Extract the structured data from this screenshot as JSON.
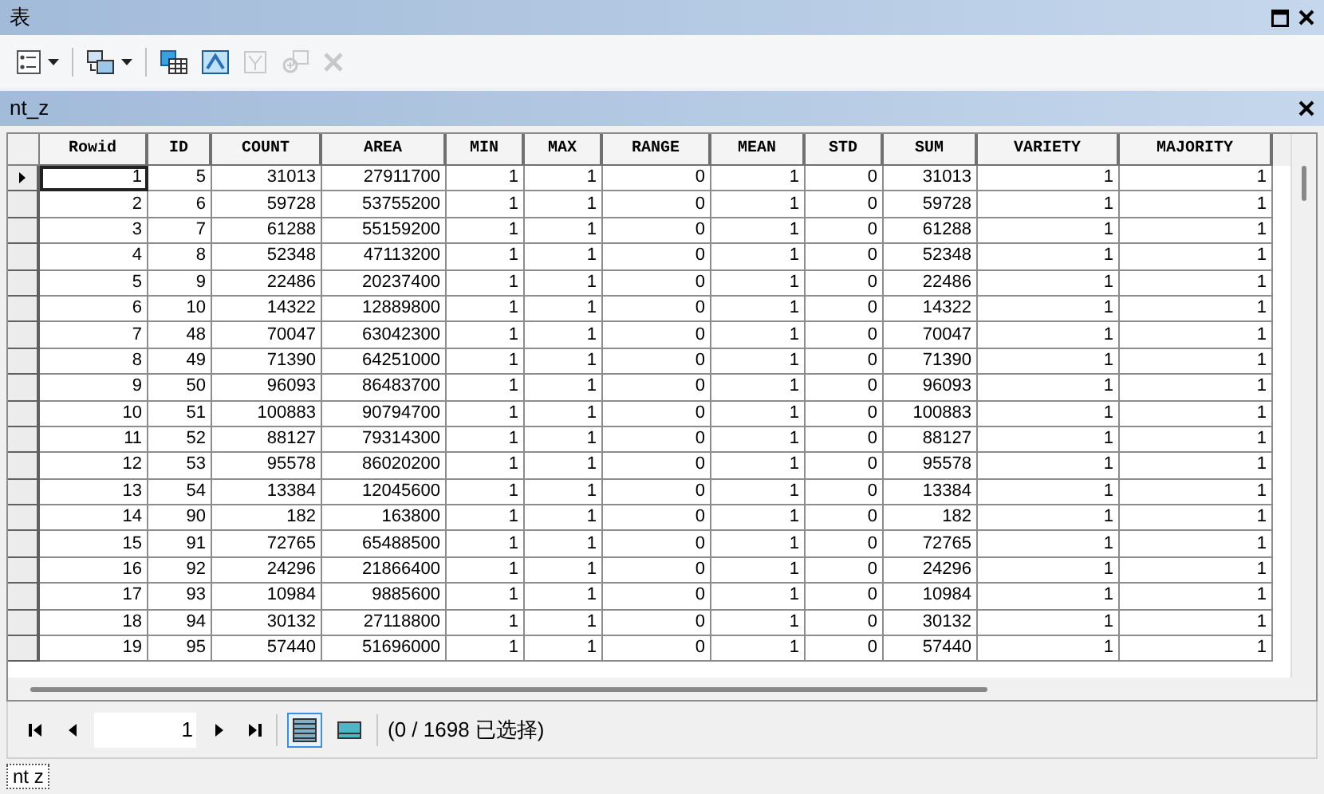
{
  "window": {
    "title": "表"
  },
  "toolbar": [
    {
      "kind": "options",
      "dropdown": true,
      "disabled": false
    },
    {
      "kind": "related",
      "dropdown": true,
      "disabled": false
    },
    {
      "kind": "select",
      "dropdown": false,
      "disabled": false
    },
    {
      "kind": "switch",
      "dropdown": false,
      "disabled": false
    },
    {
      "kind": "clear",
      "dropdown": false,
      "disabled": true
    },
    {
      "kind": "zoom",
      "dropdown": false,
      "disabled": true
    },
    {
      "kind": "delete",
      "dropdown": false,
      "disabled": true
    }
  ],
  "table_tab": {
    "title": "nt_z"
  },
  "table": {
    "columns": [
      "Rowid",
      "ID",
      "COUNT",
      "AREA",
      "MIN",
      "MAX",
      "RANGE",
      "MEAN",
      "STD",
      "SUM",
      "VARIETY",
      "MAJORITY"
    ],
    "rows": [
      {
        "current": true,
        "cells": [
          "1",
          "5",
          "31013",
          "27911700",
          "1",
          "1",
          "0",
          "1",
          "0",
          "31013",
          "1",
          "1"
        ]
      },
      {
        "current": false,
        "cells": [
          "2",
          "6",
          "59728",
          "53755200",
          "1",
          "1",
          "0",
          "1",
          "0",
          "59728",
          "1",
          "1"
        ]
      },
      {
        "current": false,
        "cells": [
          "3",
          "7",
          "61288",
          "55159200",
          "1",
          "1",
          "0",
          "1",
          "0",
          "61288",
          "1",
          "1"
        ]
      },
      {
        "current": false,
        "cells": [
          "4",
          "8",
          "52348",
          "47113200",
          "1",
          "1",
          "0",
          "1",
          "0",
          "52348",
          "1",
          "1"
        ]
      },
      {
        "current": false,
        "cells": [
          "5",
          "9",
          "22486",
          "20237400",
          "1",
          "1",
          "0",
          "1",
          "0",
          "22486",
          "1",
          "1"
        ]
      },
      {
        "current": false,
        "cells": [
          "6",
          "10",
          "14322",
          "12889800",
          "1",
          "1",
          "0",
          "1",
          "0",
          "14322",
          "1",
          "1"
        ]
      },
      {
        "current": false,
        "cells": [
          "7",
          "48",
          "70047",
          "63042300",
          "1",
          "1",
          "0",
          "1",
          "0",
          "70047",
          "1",
          "1"
        ]
      },
      {
        "current": false,
        "cells": [
          "8",
          "49",
          "71390",
          "64251000",
          "1",
          "1",
          "0",
          "1",
          "0",
          "71390",
          "1",
          "1"
        ]
      },
      {
        "current": false,
        "cells": [
          "9",
          "50",
          "96093",
          "86483700",
          "1",
          "1",
          "0",
          "1",
          "0",
          "96093",
          "1",
          "1"
        ]
      },
      {
        "current": false,
        "cells": [
          "10",
          "51",
          "100883",
          "90794700",
          "1",
          "1",
          "0",
          "1",
          "0",
          "100883",
          "1",
          "1"
        ]
      },
      {
        "current": false,
        "cells": [
          "11",
          "52",
          "88127",
          "79314300",
          "1",
          "1",
          "0",
          "1",
          "0",
          "88127",
          "1",
          "1"
        ]
      },
      {
        "current": false,
        "cells": [
          "12",
          "53",
          "95578",
          "86020200",
          "1",
          "1",
          "0",
          "1",
          "0",
          "95578",
          "1",
          "1"
        ]
      },
      {
        "current": false,
        "cells": [
          "13",
          "54",
          "13384",
          "12045600",
          "1",
          "1",
          "0",
          "1",
          "0",
          "13384",
          "1",
          "1"
        ]
      },
      {
        "current": false,
        "cells": [
          "14",
          "90",
          "182",
          "163800",
          "1",
          "1",
          "0",
          "1",
          "0",
          "182",
          "1",
          "1"
        ]
      },
      {
        "current": false,
        "cells": [
          "15",
          "91",
          "72765",
          "65488500",
          "1",
          "1",
          "0",
          "1",
          "0",
          "72765",
          "1",
          "1"
        ]
      },
      {
        "current": false,
        "cells": [
          "16",
          "92",
          "24296",
          "21866400",
          "1",
          "1",
          "0",
          "1",
          "0",
          "24296",
          "1",
          "1"
        ]
      },
      {
        "current": false,
        "cells": [
          "17",
          "93",
          "10984",
          "9885600",
          "1",
          "1",
          "0",
          "1",
          "0",
          "10984",
          "1",
          "1"
        ]
      },
      {
        "current": false,
        "cells": [
          "18",
          "94",
          "30132",
          "27118800",
          "1",
          "1",
          "0",
          "1",
          "0",
          "30132",
          "1",
          "1"
        ]
      },
      {
        "current": false,
        "cells": [
          "19",
          "95",
          "57440",
          "51696000",
          "1",
          "1",
          "0",
          "1",
          "0",
          "57440",
          "1",
          "1"
        ]
      }
    ]
  },
  "navigator": {
    "record": "1",
    "views": [
      {
        "kind": "all",
        "selected": true
      },
      {
        "kind": "selected",
        "selected": false
      }
    ],
    "status": "(0 / 1698 已选择)"
  },
  "bottom_tab": {
    "label": "nt z"
  }
}
